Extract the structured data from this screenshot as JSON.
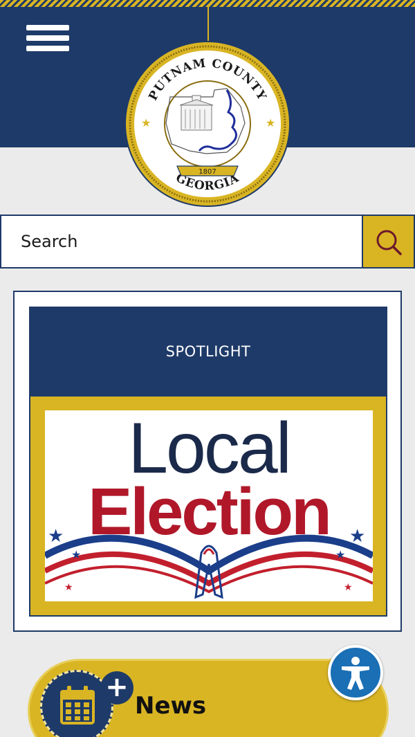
{
  "header": {
    "menu_label": "Menu",
    "seal": {
      "top_text": "PUTNAM COUNTY",
      "bottom_text": "GEORGIA",
      "year": "1807"
    }
  },
  "search": {
    "placeholder": "Search"
  },
  "spotlight": {
    "heading": "SPOTLIGHT",
    "image_text_line1": "Local",
    "image_text_line2": "Election"
  },
  "news": {
    "label": "News",
    "plus": "+"
  },
  "colors": {
    "navy": "#1e3a68",
    "gold": "#d9b524",
    "background": "#ebebeb",
    "accessibility_blue": "#1a6fb5",
    "election_red": "#b0182a"
  },
  "icons": {
    "menu": "hamburger-icon",
    "search": "search-icon",
    "calendar": "calendar-icon",
    "accessibility": "accessibility-icon"
  }
}
